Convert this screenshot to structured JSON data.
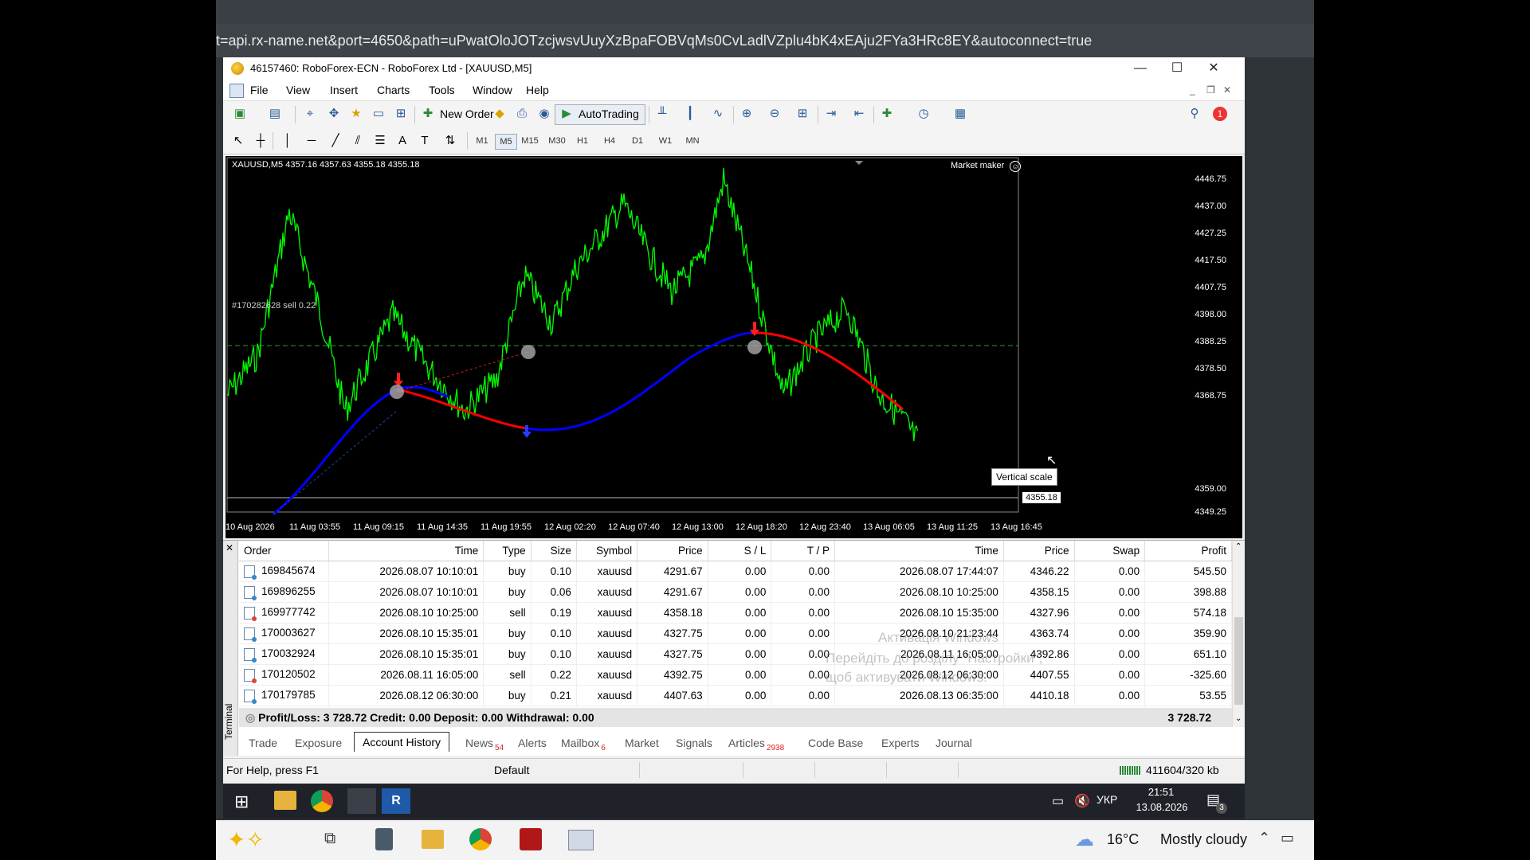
{
  "browser": {
    "url": "t=api.rx-name.net&port=4650&path=uPwatOloJOTzcjwsvUuyXzBpaFOBVqMs0CvLadlVZplu4bK4xEAju2FYa3HRc8EY&autoconnect=true"
  },
  "window": {
    "title": "46157460: RoboForex-ECN - RoboForex Ltd - [XAUUSD,M5]",
    "controls": {
      "minimize": "—",
      "maximize": "☐",
      "close": "✕"
    }
  },
  "menu": [
    "File",
    "View",
    "Insert",
    "Charts",
    "Tools",
    "Window",
    "Help"
  ],
  "toolbar": {
    "new_order": "New Order",
    "autotrading": "AutoTrading",
    "notification_count": "1"
  },
  "timeframes": [
    "M1",
    "M5",
    "M15",
    "M30",
    "H1",
    "H4",
    "D1",
    "W1",
    "MN"
  ],
  "timeframe_active": "M5",
  "chart": {
    "header": "XAUUSD,M5  4357.16 4357.63 4355.18 4355.18",
    "market_maker": "Market maker",
    "order_line_label": "#170282628 sell 0.22",
    "tooltip": "Vertical scale",
    "current_price": "4355.18",
    "price_labels": [
      "4446.75",
      "4437.00",
      "4427.25",
      "4417.50",
      "4407.75",
      "4398.00",
      "4388.25",
      "4378.50",
      "4368.75",
      "4359.00",
      "4349.25"
    ],
    "time_labels": [
      "10 Aug 2026",
      "11 Aug 03:55",
      "11 Aug 09:15",
      "11 Aug 14:35",
      "11 Aug 19:55",
      "12 Aug 02:20",
      "12 Aug 07:40",
      "12 Aug 13:00",
      "12 Aug 18:20",
      "12 Aug 23:40",
      "13 Aug 06:05",
      "13 Aug 11:25",
      "13 Aug 16:45"
    ],
    "colors": {
      "price": "#00ff00",
      "ma_up": "#0000ff",
      "ma_down": "#ff0000",
      "background": "#000000"
    }
  },
  "history": {
    "columns": [
      "Order",
      "Time",
      "Type",
      "Size",
      "Symbol",
      "Price",
      "S / L",
      "T / P",
      "Time",
      "Price",
      "Swap",
      "Profit"
    ],
    "rows": [
      {
        "order": "169845674",
        "time": "2026.08.07 10:10:01",
        "type": "buy",
        "size": "0.10",
        "symbol": "xauusd",
        "price": "4291.67",
        "sl": "0.00",
        "tp": "0.00",
        "close_time": "2026.08.07 17:44:07",
        "close_price": "4346.22",
        "swap": "0.00",
        "profit": "545.50"
      },
      {
        "order": "169896255",
        "time": "2026.08.07 10:10:01",
        "type": "buy",
        "size": "0.06",
        "symbol": "xauusd",
        "price": "4291.67",
        "sl": "0.00",
        "tp": "0.00",
        "close_time": "2026.08.10 10:25:00",
        "close_price": "4358.15",
        "swap": "0.00",
        "profit": "398.88"
      },
      {
        "order": "169977742",
        "time": "2026.08.10 10:25:00",
        "type": "sell",
        "size": "0.19",
        "symbol": "xauusd",
        "price": "4358.18",
        "sl": "0.00",
        "tp": "0.00",
        "close_time": "2026.08.10 15:35:00",
        "close_price": "4327.96",
        "swap": "0.00",
        "profit": "574.18"
      },
      {
        "order": "170003627",
        "time": "2026.08.10 15:35:01",
        "type": "buy",
        "size": "0.10",
        "symbol": "xauusd",
        "price": "4327.75",
        "sl": "0.00",
        "tp": "0.00",
        "close_time": "2026.08.10 21:23:44",
        "close_price": "4363.74",
        "swap": "0.00",
        "profit": "359.90"
      },
      {
        "order": "170032924",
        "time": "2026.08.10 15:35:01",
        "type": "buy",
        "size": "0.10",
        "symbol": "xauusd",
        "price": "4327.75",
        "sl": "0.00",
        "tp": "0.00",
        "close_time": "2026.08.11 16:05:00",
        "close_price": "4392.86",
        "swap": "0.00",
        "profit": "651.10"
      },
      {
        "order": "170120502",
        "time": "2026.08.11 16:05:00",
        "type": "sell",
        "size": "0.22",
        "symbol": "xauusd",
        "price": "4392.75",
        "sl": "0.00",
        "tp": "0.00",
        "close_time": "2026.08.12 06:30:00",
        "close_price": "4407.55",
        "swap": "0.00",
        "profit": "-325.60"
      },
      {
        "order": "170179785",
        "time": "2026.08.12 06:30:00",
        "type": "buy",
        "size": "0.21",
        "symbol": "xauusd",
        "price": "4407.63",
        "sl": "0.00",
        "tp": "0.00",
        "close_time": "2026.08.13 06:35:00",
        "close_price": "4410.18",
        "swap": "0.00",
        "profit": "53.55"
      }
    ],
    "summary": "Profit/Loss: 3 728.72  Credit: 0.00  Deposit: 0.00  Withdrawal: 0.00",
    "summary_total": "3 728.72"
  },
  "terminal_label": "Terminal",
  "tabs": [
    {
      "label": "Trade",
      "badge": ""
    },
    {
      "label": "Exposure",
      "badge": ""
    },
    {
      "label": "Account History",
      "badge": ""
    },
    {
      "label": "News",
      "badge": "54"
    },
    {
      "label": "Alerts",
      "badge": ""
    },
    {
      "label": "Mailbox",
      "badge": "6"
    },
    {
      "label": "Market",
      "badge": ""
    },
    {
      "label": "Signals",
      "badge": ""
    },
    {
      "label": "Articles",
      "badge": "2938"
    },
    {
      "label": "Code Base",
      "badge": ""
    },
    {
      "label": "Experts",
      "badge": ""
    },
    {
      "label": "Journal",
      "badge": ""
    }
  ],
  "active_tab": "Account History",
  "status": {
    "help": "For Help, press F1",
    "profile": "Default",
    "traffic": "411604/320 kb"
  },
  "watermark": {
    "line1": "Активація Windows",
    "line2": "Перейдіть до розділу \"Настройки\",",
    "line3": "щоб активувати Windows."
  },
  "taskbar": {
    "lang": "УКР",
    "time": "21:51",
    "date": "13.08.2026",
    "notif": "3"
  },
  "host_taskbar": {
    "weather_temp": "16°C",
    "weather_text": "Mostly cloudy"
  }
}
